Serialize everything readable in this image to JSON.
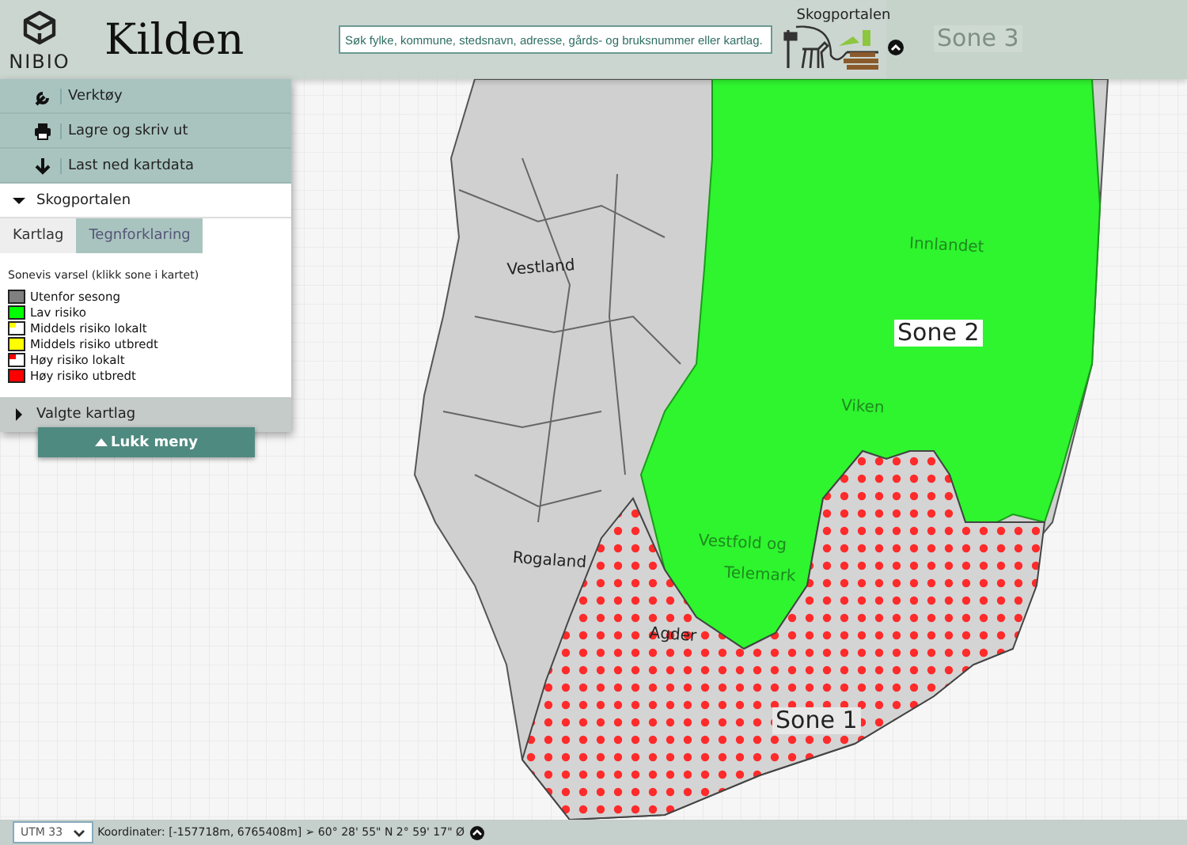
{
  "header": {
    "logo_text": "NIBIO",
    "title": "Kilden",
    "search": {
      "placeholder": "Søk fylke, kommune, stedsnavn, adresse, gårds- og bruksnummer eller kartlag."
    },
    "portal": {
      "label": "Skogportalen"
    }
  },
  "menu": {
    "items": [
      {
        "label": "Verktøy",
        "kind": "wrench"
      },
      {
        "label": "Lagre og skriv ut",
        "kind": "print"
      },
      {
        "label": "Last ned kartdata",
        "kind": "download"
      }
    ],
    "sections": [
      {
        "title": "Skogportalen",
        "expanded": true,
        "tabs": [
          {
            "label": "Kartlag",
            "selected": false
          },
          {
            "label": "Tegnforklaring",
            "selected": true
          }
        ],
        "legend": {
          "title": "Sonevis varsel (klikk sone i kartet)",
          "items": [
            {
              "label": "Utenfor sesong",
              "color": "#808080",
              "kind": "solid"
            },
            {
              "label": "Lav risiko",
              "color": "#00ff00",
              "kind": "solid"
            },
            {
              "label": "Middels risiko lokalt",
              "color": "#ffff00",
              "kind": "corner"
            },
            {
              "label": "Middels risiko utbredt",
              "color": "#ffff00",
              "kind": "solid"
            },
            {
              "label": "Høy risiko lokalt",
              "color": "#ff0000",
              "kind": "corner"
            },
            {
              "label": "Høy risiko utbredt",
              "color": "#ff0000",
              "kind": "solid"
            }
          ]
        }
      },
      {
        "title": "Valgte kartlag",
        "expanded": false
      }
    ],
    "close_button": "Lukk meny"
  },
  "map": {
    "zones": [
      {
        "label": "Sone 3",
        "kind": "faded"
      },
      {
        "label": "Sone 2",
        "kind": "green"
      },
      {
        "label": "Sone 1",
        "kind": "dotted"
      }
    ],
    "places": [
      {
        "label": "Vestland"
      },
      {
        "label": "Rogaland"
      },
      {
        "label": "Agder"
      },
      {
        "label": "Innlandet"
      },
      {
        "label": "Viken"
      },
      {
        "label": "Vestfold og"
      },
      {
        "label": "Telemark"
      }
    ]
  },
  "status_bar": {
    "projection": "UTM 33",
    "coordinates": "Koordinater: [-157718m, 6765408m] ➢ 60° 28' 55\" N 2° 59' 17\" Ø"
  }
}
